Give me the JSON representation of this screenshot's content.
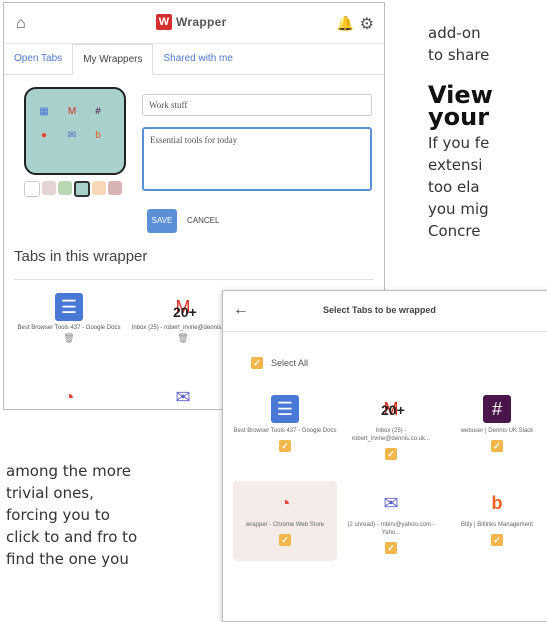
{
  "panel1": {
    "brand": "Wrapper",
    "brand_letter": "W",
    "tabs": [
      {
        "label": "Open Tabs"
      },
      {
        "label": "My Wrappers"
      },
      {
        "label": "Shared with me"
      }
    ],
    "wrapper_name": "Work stuff",
    "wrapper_description": "Essential tools for today",
    "save_label": "SAVE",
    "cancel_label": "CANCEL",
    "section_title": "Tabs in this wrapper",
    "tabs_in_wrapper": [
      {
        "title": "Best Browser Tools 437 - Google Docs",
        "icon": "docs-icon"
      },
      {
        "title": "Inbox (25) - robert_irvine@dennis.co...",
        "icon": "gmail-icon",
        "badge": "20+"
      },
      {
        "title": "",
        "icon": "slack-icon"
      }
    ],
    "swatch_colors": [
      "#ffffff",
      "#e6d3d3",
      "#b9d7b2",
      "#a8d0cd",
      "#f8d8b6",
      "#d8b3b3"
    ]
  },
  "article_top": {
    "lines": [
      "add-on",
      "to share"
    ],
    "heading": [
      "View",
      "your"
    ],
    "body": [
      "If you fe",
      "extensi",
      "too ela",
      "you mig",
      "Concre"
    ]
  },
  "article_bottom": {
    "lines": [
      "among the more",
      "trivial ones,",
      "forcing you to",
      "click to and fro to",
      "find the one you"
    ]
  },
  "panel2": {
    "title": "Select Tabs to be wrapped",
    "select_all": "Select All",
    "tiles": [
      {
        "title": "Best Browser Tools 437 - Google Docs",
        "icon": "docs-icon"
      },
      {
        "title": "Inbox (25) - robert_irvine@dennis.co.uk...",
        "icon": "gmail-icon",
        "badge": "20+"
      },
      {
        "title": "webuser | Dennis UK Slack",
        "icon": "slack-icon"
      },
      {
        "title": "wrapper - Chrome Web Store",
        "icon": "chrome-web-store-icon"
      },
      {
        "title": "(2 unread) - rnbirv@yahoo.com - Yaho...",
        "icon": "mail-icon"
      },
      {
        "title": "Bitly | Bitlinks Management",
        "icon": "bitly-icon"
      }
    ]
  },
  "colors": {
    "accent_blue": "#5b8fd6",
    "checkbox_orange": "#f1b64c",
    "wrapper_thumb": "#a8d0cd"
  }
}
